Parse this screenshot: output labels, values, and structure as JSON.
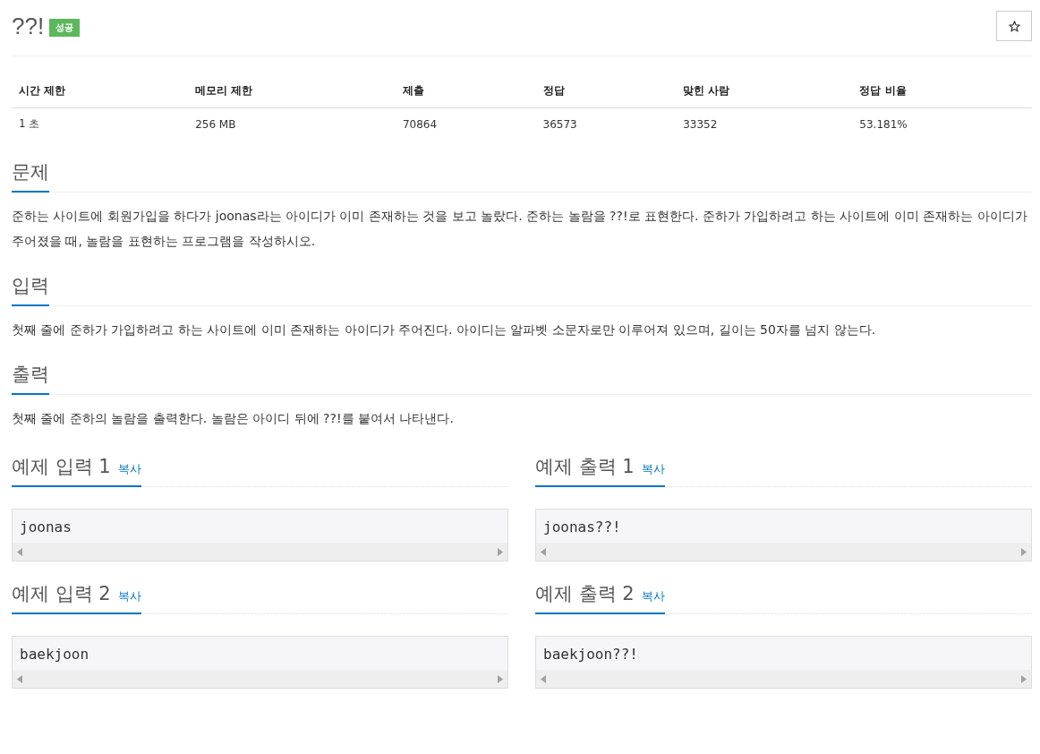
{
  "problem": {
    "title": "??!",
    "badge": "성공"
  },
  "info_table": {
    "columns": [
      "시간 제한",
      "메모리 제한",
      "제출",
      "정답",
      "맞힌 사람",
      "정답 비율"
    ],
    "rows": [
      [
        "1 초",
        "256 MB",
        "70864",
        "36573",
        "33352",
        "53.181%"
      ]
    ]
  },
  "sections": [
    {
      "heading": "문제",
      "body": "준하는 사이트에 회원가입을 하다가 joonas라는 아이디가 이미 존재하는 것을 보고 놀랐다. 준하는 놀람을 ??!로 표현한다. 준하가 가입하려고 하는 사이트에 이미 존재하는 아이디가 주어졌을 때, 놀람을 표현하는 프로그램을 작성하시오."
    },
    {
      "heading": "입력",
      "body": "첫째 줄에 준하가 가입하려고 하는 사이트에 이미 존재하는 아이디가 주어진다. 아이디는 알파벳 소문자로만 이루어져 있으며, 길이는 50자를 넘지 않는다."
    },
    {
      "heading": "출력",
      "body": "첫째 줄에 준하의 놀람을 출력한다. 놀람은 아이디 뒤에 ??!를 붙여서 나타낸다."
    }
  ],
  "samples": [
    {
      "input": {
        "heading": "예제 입력 1",
        "copy": "복사",
        "code": "joonas"
      },
      "output": {
        "heading": "예제 출력 1",
        "copy": "복사",
        "code": "joonas??!"
      }
    },
    {
      "input": {
        "heading": "예제 입력 2",
        "copy": "복사",
        "code": "baekjoon"
      },
      "output": {
        "heading": "예제 출력 2",
        "copy": "복사",
        "code": "baekjoon??!"
      }
    }
  ]
}
